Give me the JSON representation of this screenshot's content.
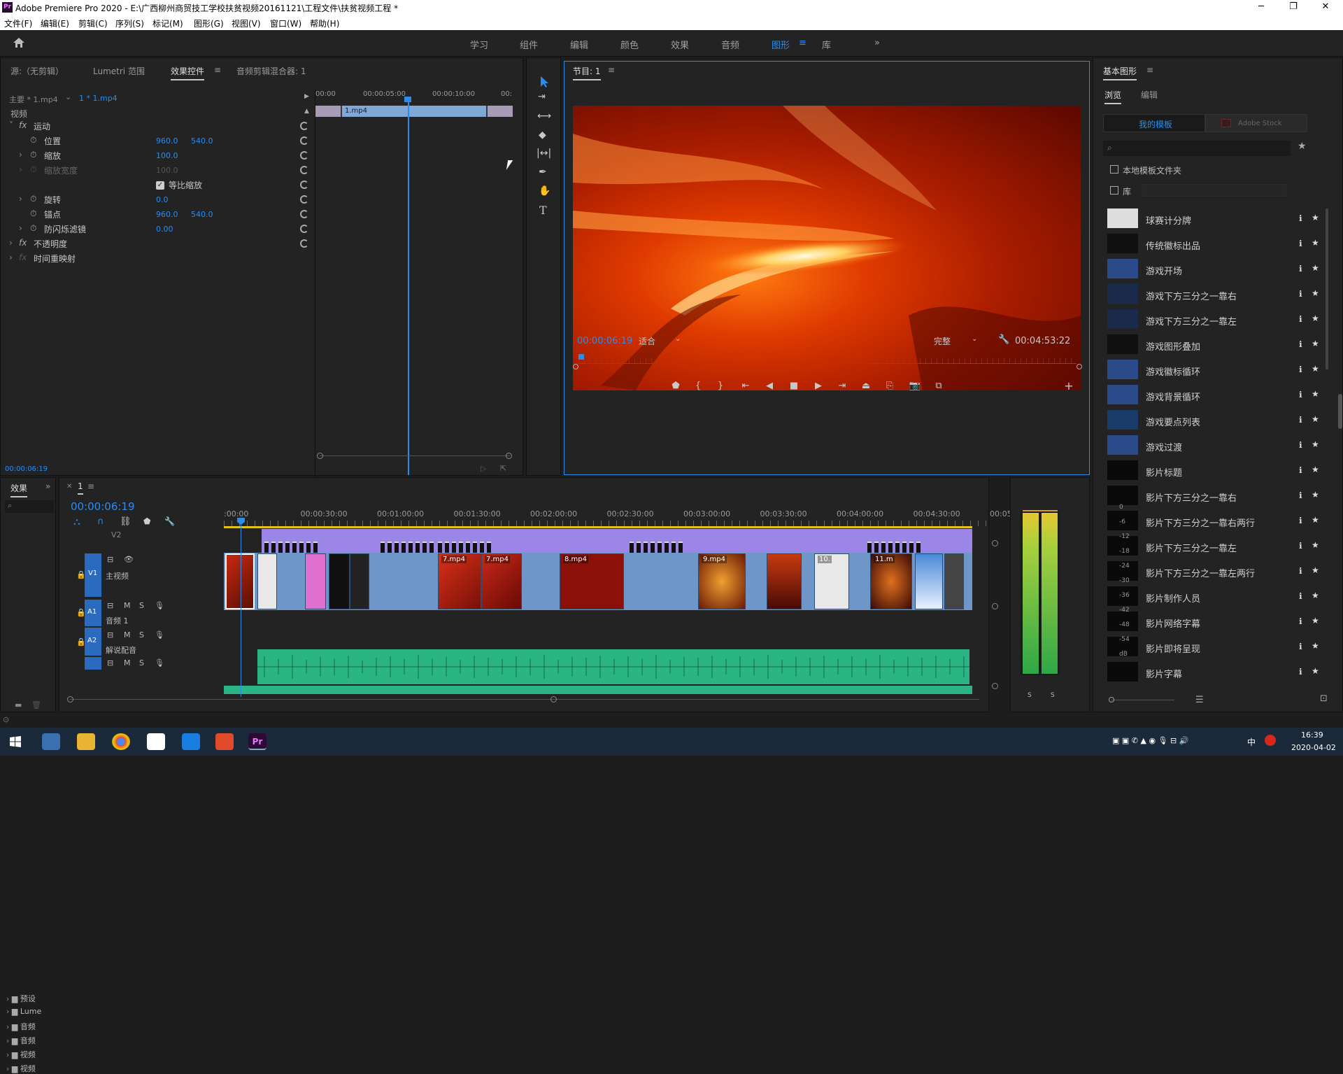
{
  "titlebar": {
    "title": "Adobe Premiere Pro 2020 - E:\\广西柳州商贸技工学校扶贫视频20161121\\工程文件\\扶贫视频工程 *",
    "min": "─",
    "max": "❐",
    "close": "✕"
  },
  "menu": [
    "文件(F)",
    "编辑(E)",
    "剪辑(C)",
    "序列(S)",
    "标记(M)",
    "图形(G)",
    "视图(V)",
    "窗口(W)",
    "帮助(H)"
  ],
  "workspaces": [
    "学习",
    "组件",
    "编辑",
    "颜色",
    "效果",
    "音频",
    "图形",
    "库"
  ],
  "workspace_active": "图形",
  "effect_controls": {
    "tabs": [
      "源:（无剪辑）",
      "Lumetri 范围",
      "效果控件",
      "音频剪辑混合器: 1"
    ],
    "master": "主要 * 1.mp4",
    "clip": "1 * 1.mp4",
    "ruler": [
      "00:00",
      "00:00:05:00",
      "00:00:10:00",
      "00:"
    ],
    "clip_bar": "1.mp4",
    "section_video": "视频",
    "motion": "运动",
    "props": [
      {
        "name": "位置",
        "v1": "960.0",
        "v2": "540.0"
      },
      {
        "name": "缩放",
        "v1": "100.0",
        "v2": ""
      },
      {
        "name": "缩放宽度",
        "v1": "100.0",
        "v2": ""
      },
      {
        "name": "等比缩放",
        "v1": "",
        "v2": ""
      },
      {
        "name": "旋转",
        "v1": "0.0",
        "v2": ""
      },
      {
        "name": "锚点",
        "v1": "960.0",
        "v2": "540.0"
      },
      {
        "name": "防闪烁滤镜",
        "v1": "0.00",
        "v2": ""
      }
    ],
    "opacity": "不透明度",
    "timeremap": "时间重映射",
    "timecode": "00:00:06:19"
  },
  "program": {
    "title": "节目: 1",
    "timecode": "00:00:06:19",
    "fit": "适合",
    "quality": "完整",
    "duration": "00:04:53:22"
  },
  "essential_graphics": {
    "title": "基本图形",
    "tabs": [
      "浏览",
      "编辑"
    ],
    "btn_my": "我的模板",
    "btn_stock": "Adobe Stock",
    "chk_local": "本地模板文件夹",
    "chk_lib": "库",
    "items": [
      "球赛计分牌",
      "传统徽标出品",
      "游戏开场",
      "游戏下方三分之一靠右",
      "游戏下方三分之一靠左",
      "游戏图形叠加",
      "游戏徽标循环",
      "游戏背景循环",
      "游戏要点列表",
      "游戏过渡",
      "影片标题",
      "影片下方三分之一靠右",
      "影片下方三分之一靠右两行",
      "影片下方三分之一靠左",
      "影片下方三分之一靠左两行",
      "影片制作人员",
      "影片网络字幕",
      "影片即将呈现",
      "影片字幕"
    ]
  },
  "effects_panel": {
    "tab": "效果",
    "items": [
      "预设",
      "Lume",
      "音频",
      "音频",
      "视频",
      "视频"
    ]
  },
  "timeline": {
    "seq": "1",
    "timecode": "00:00:06:19",
    "ruler": [
      ":00:00",
      "00:00:30:00",
      "00:01:00:00",
      "00:01:30:00",
      "00:02:00:00",
      "00:02:30:00",
      "00:03:00:00",
      "00:03:30:00",
      "00:04:00:00",
      "00:04:30:00",
      "00:05:"
    ],
    "v2": "V2",
    "v1": "V1",
    "v1_name": "主视频",
    "a1": "A1",
    "a1_name": "音频 1",
    "a2": "A2",
    "a2_name": "解说配音",
    "clips": [
      "7.mp4",
      "7.mp4",
      "8.mp4",
      "9.mp4",
      "10.",
      "11.m"
    ]
  },
  "meter": {
    "scale": [
      "0",
      "-6",
      "-12",
      "-18",
      "-24",
      "-30",
      "-36",
      "-42",
      "-48",
      "-54",
      "dB"
    ],
    "s1": "S",
    "s2": "S"
  },
  "taskbar": {
    "time": "16:39",
    "date": "2020-04-02",
    "ime": "中"
  }
}
